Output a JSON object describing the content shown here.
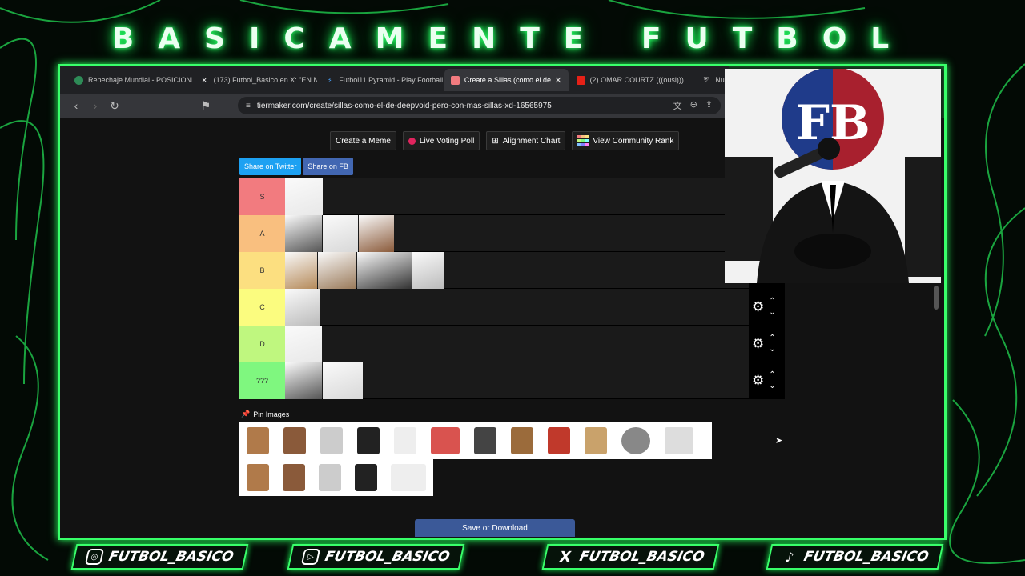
{
  "banner": {
    "title": "BASICAMENTE FUTBOL"
  },
  "browser": {
    "tabs": [
      {
        "label": "Repechaje Mundial - POSICIONES",
        "icon": "globe-icon",
        "active": false
      },
      {
        "label": "(173) Futbol_Basico en X: \"EN M",
        "icon": "x-logo-icon",
        "active": false
      },
      {
        "label": "Futbol11 Pyramid - Play Football",
        "icon": "f11-icon",
        "active": false
      },
      {
        "label": "Create a Sillas (como el de",
        "icon": "tiermaker-icon",
        "active": true
      },
      {
        "label": "(2) OMAR COURTZ (((ousi)))",
        "icon": "youtube-icon",
        "active": false
      },
      {
        "label": "Nue",
        "icon": "shield-icon",
        "active": false
      }
    ],
    "url": "tiermaker.com/create/sillas-como-el-de-deepvoid-pero-con-mas-sillas-xd-16565975"
  },
  "toolbar": {
    "create_meme": "Create a Meme",
    "live_voting": "Live Voting Poll",
    "alignment": "Alignment Chart",
    "community": "View Community Rank"
  },
  "share": {
    "twitter": "Share on Twitter",
    "facebook": "Share on FB"
  },
  "tiers": [
    {
      "label": "S",
      "color": "#f27b7f",
      "items": [
        "toilet-seat"
      ]
    },
    {
      "label": "A",
      "color": "#f9bf7f",
      "items": [
        "bed-chair",
        "gaming-chair",
        "car-seat"
      ]
    },
    {
      "label": "B",
      "color": "#fcdf80",
      "items": [
        "plastic-chair",
        "armchair",
        "bench",
        "school-desk"
      ]
    },
    {
      "label": "C",
      "color": "#fbfc7f",
      "items": [
        "waiting-chairs"
      ]
    },
    {
      "label": "D",
      "color": "#bff77f",
      "items": [
        "commode-chair"
      ]
    },
    {
      "label": "???",
      "color": "#7ff77f",
      "items": [
        "figure-seat",
        "mermaid-tail"
      ]
    }
  ],
  "pin_label": "Pin Images",
  "pool_row1": [
    "bar-stool",
    "wood-chair",
    "small-chair",
    "office-chair",
    "plastic-chair",
    "deck-chair",
    "wheelchair",
    "high-chair",
    "gaming-chair",
    "rocking-chair",
    "rock",
    "baby-chair"
  ],
  "pool_row2": [
    "folding-chair",
    "beach-chair",
    "throne",
    "white-chair",
    "sofa"
  ],
  "save_label": "Save or Download",
  "socials": [
    {
      "label": "FUTBOL_BASICO",
      "icon": "instagram-icon",
      "glyph": "◎"
    },
    {
      "label": "FUTBOL_BASICO",
      "icon": "youtube-icon",
      "glyph": "▷"
    },
    {
      "label": "FUTBOL_BASICO",
      "icon": "x-icon",
      "glyph": "X"
    },
    {
      "label": "FUTBOL_BASICO",
      "icon": "tiktok-icon",
      "glyph": "♪"
    }
  ],
  "colors": {
    "neon": "#39ff6a",
    "twitter": "#1da1f2",
    "facebook": "#4267b2",
    "save": "#3b5998"
  }
}
